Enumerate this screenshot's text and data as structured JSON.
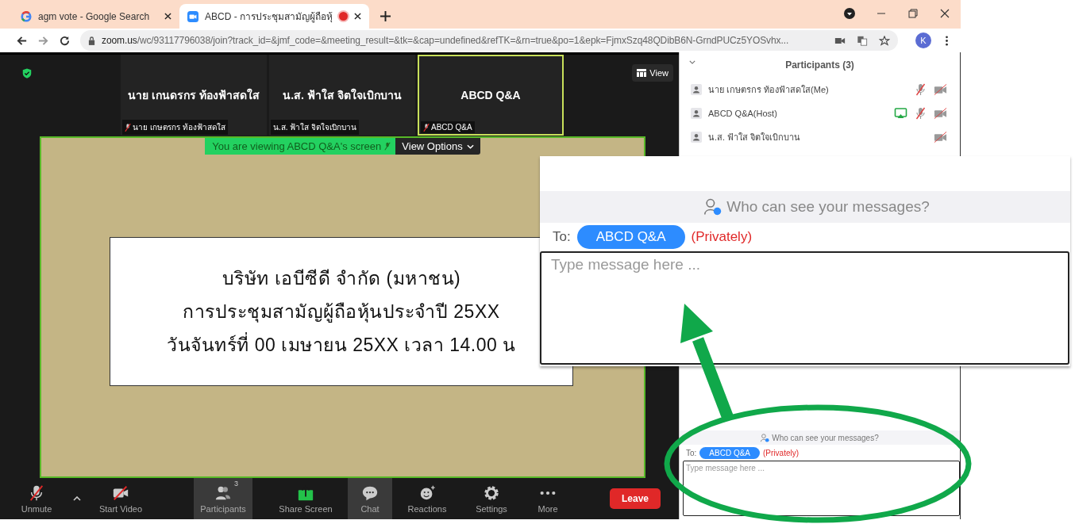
{
  "browser": {
    "tabs": [
      {
        "title": "agm vote - Google Search",
        "selected": false,
        "recording": false
      },
      {
        "title": "ABCD - การประชุมสามัญผู้ถือหุ้",
        "selected": true,
        "recording": true
      }
    ],
    "address": {
      "domain": "zoom.us",
      "path": "/wc/93117796038/join?track_id=&jmf_code=&meeting_result=&tk=&cap=undefined&refTK=&rn=true&po=1&epk=FjmxSzq48QDibB6N-GrndPUCz5YOSvhx..."
    },
    "profile": "K"
  },
  "meeting": {
    "view_button": "View",
    "tiles": [
      {
        "name": "นาย เกนดรกร ท้องฟ้าสดใส",
        "label": "นาย เกษตรกร ท้องฟ้าสดใส",
        "mic_muted": true,
        "active": false
      },
      {
        "name": "น.ส. ฟ้าใส จิตใจเบิกบาน",
        "label": "น.ส. ฟ้าใส จิตใจเบิกบาน",
        "mic_muted": false,
        "active": false
      },
      {
        "name": "ABCD Q&A",
        "label": "ABCD Q&A",
        "mic_muted": true,
        "active": true
      }
    ],
    "share_banner": {
      "text": "You are viewing ABCD Q&A's screen",
      "options": "View Options"
    },
    "slide": [
      "บริษัท เอบีซีดี จำกัด (มหาชน)",
      "การประชุมสามัญผู้ถือหุ้นประจำปี 25XX",
      "วันจันทร์ที่ 00 เมษายน 25XX เวลา 14.00 น"
    ],
    "toolbar": [
      {
        "kind": "mic",
        "label": "Unmute",
        "active": false
      },
      {
        "kind": "caret",
        "active": false
      },
      {
        "kind": "video",
        "label": "Start Video",
        "active": false
      },
      {
        "kind": "participants",
        "label": "Participants",
        "count": "3",
        "active": true
      },
      {
        "kind": "share",
        "label": "Share Screen",
        "active": false
      },
      {
        "kind": "chat",
        "label": "Chat",
        "active": true
      },
      {
        "kind": "reactions",
        "label": "Reactions",
        "active": false
      },
      {
        "kind": "settings",
        "label": "Settings",
        "active": false
      },
      {
        "kind": "more",
        "label": "More",
        "active": false
      },
      {
        "kind": "leave",
        "label": "Leave",
        "active": false
      }
    ]
  },
  "participants_panel": {
    "title": "Participants (3)",
    "participants": [
      {
        "name": "นาย เกษตรกร ท้องฟ้าสดใส(Me)",
        "sharing": false,
        "mic_visible": true,
        "mic_muted": true,
        "video_off": true
      },
      {
        "name": "ABCD Q&A(Host)",
        "sharing": true,
        "mic_visible": true,
        "mic_muted": true,
        "video_off": true
      },
      {
        "name": "น.ส. ฟ้าใส จิตใจเบิกบาน",
        "sharing": false,
        "mic_visible": false,
        "video_off": true
      }
    ]
  },
  "chat": {
    "visibility": "Who can see your messages?",
    "to_label": "To:",
    "recipient": "ABCD Q&A",
    "privacy": "(Privately)",
    "placeholder": "Type message here ..."
  },
  "callout": {
    "visibility": "Who can see your messages?",
    "to_label": "To:",
    "recipient": "ABCD Q&A",
    "privacy": "(Privately)",
    "placeholder": "Type message here ..."
  }
}
